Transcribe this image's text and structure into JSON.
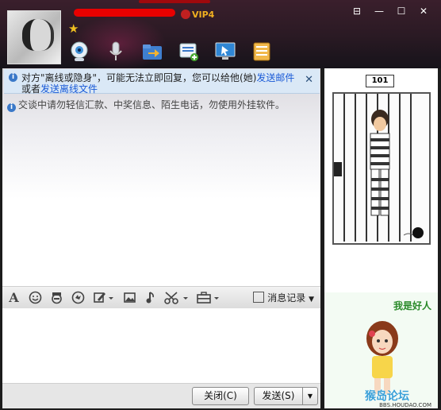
{
  "window": {
    "vip_label": "VIP4",
    "controls": [
      "⊟",
      "—",
      "☐",
      "✕"
    ]
  },
  "toolbar": {
    "icons": [
      "video-call-icon",
      "voice-call-icon",
      "send-file-icon",
      "send-message-icon",
      "remote-desktop-icon",
      "apps-icon"
    ]
  },
  "notice": {
    "line1_text": "对方\"离线或隐身\"，可能无法立即回复，您可以给他(她)",
    "line1_link": "发送邮件",
    "line2_prefix": "或者",
    "line2_link": "发送离线文件",
    "close": "✕"
  },
  "system_message": "交谈中请勿轻信汇款、中奖信息、陌生电话，勿使用外挂软件。",
  "format_bar": {
    "history_label": "消息记录"
  },
  "buttons": {
    "close_label": "关闭(C)",
    "send_label": "发送(S)",
    "dropdown": "▼"
  },
  "right_panel": {
    "cell_number": "101",
    "show_text": "我是好人",
    "watermark": "猴岛论坛",
    "watermark_url": "BBS.HOUDAO.COM"
  },
  "colors": {
    "header_bg": "#2b1a24",
    "notice_bg": "#dae8f6",
    "link": "#1a5ad7",
    "name_redacted": "#e80000"
  }
}
